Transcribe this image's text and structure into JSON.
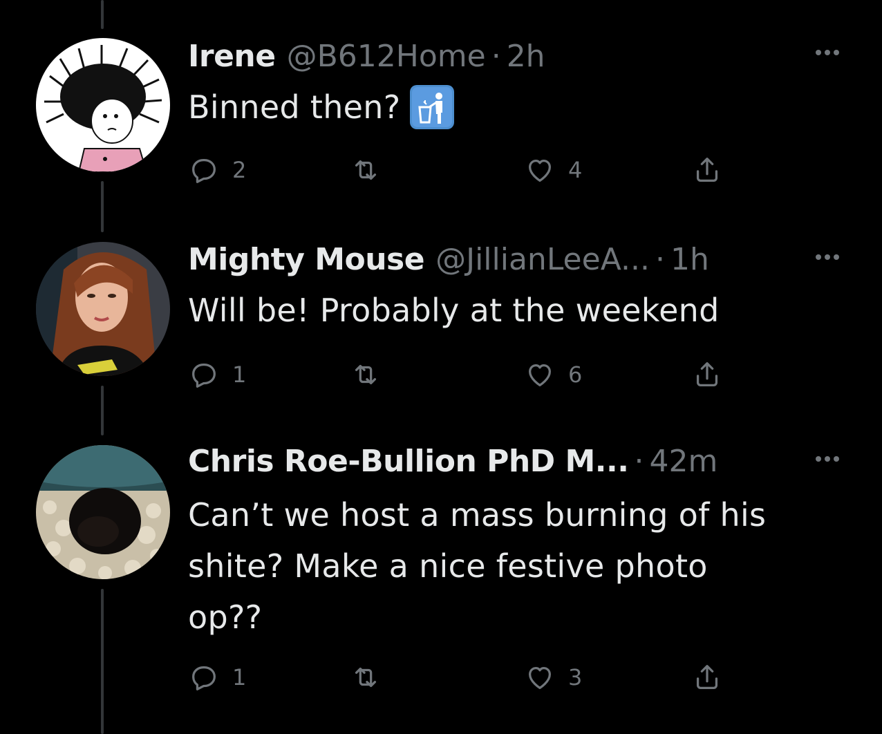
{
  "tweets": [
    {
      "name": "Irene",
      "handle": "@B612Home",
      "dot": "·",
      "time": "2h",
      "text": "Binned then?",
      "emoji": "wastebasket-emoji",
      "replies": "2",
      "retweets": "",
      "likes": "4"
    },
    {
      "name": "Mighty Mouse",
      "handle": "@JillianLeeA...",
      "dot": "·",
      "time": "1h",
      "text": "Will be! Probably at the weekend",
      "replies": "1",
      "retweets": "",
      "likes": "6"
    },
    {
      "name": "Chris Roe-Bullion PhD M...",
      "handle": "",
      "dot": "·",
      "time": "42m",
      "text_lines": [
        "Can’t we host a mass burning of his",
        "shite? Make a nice festive photo",
        "op??"
      ],
      "replies": "1",
      "retweets": "",
      "likes": "3"
    }
  ],
  "icons": {
    "reply": "reply-icon",
    "retweet": "retweet-icon",
    "like": "heart-icon",
    "share": "share-icon",
    "more": "more-icon"
  },
  "colors": {
    "background": "#000000",
    "text_primary": "#e7e9ea",
    "text_secondary": "#71767b",
    "thread_line": "#333639"
  }
}
